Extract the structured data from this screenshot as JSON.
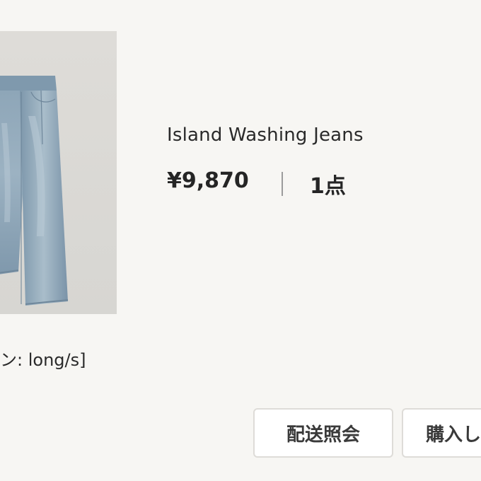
{
  "product": {
    "name": "Island Washing Jeans",
    "price": "¥9,870",
    "quantity": "1点",
    "option": "ョン: long/s]",
    "image": "jeans-photo"
  },
  "actions": {
    "inquiry_label": "配送照会",
    "purchase_label": "購入し"
  }
}
